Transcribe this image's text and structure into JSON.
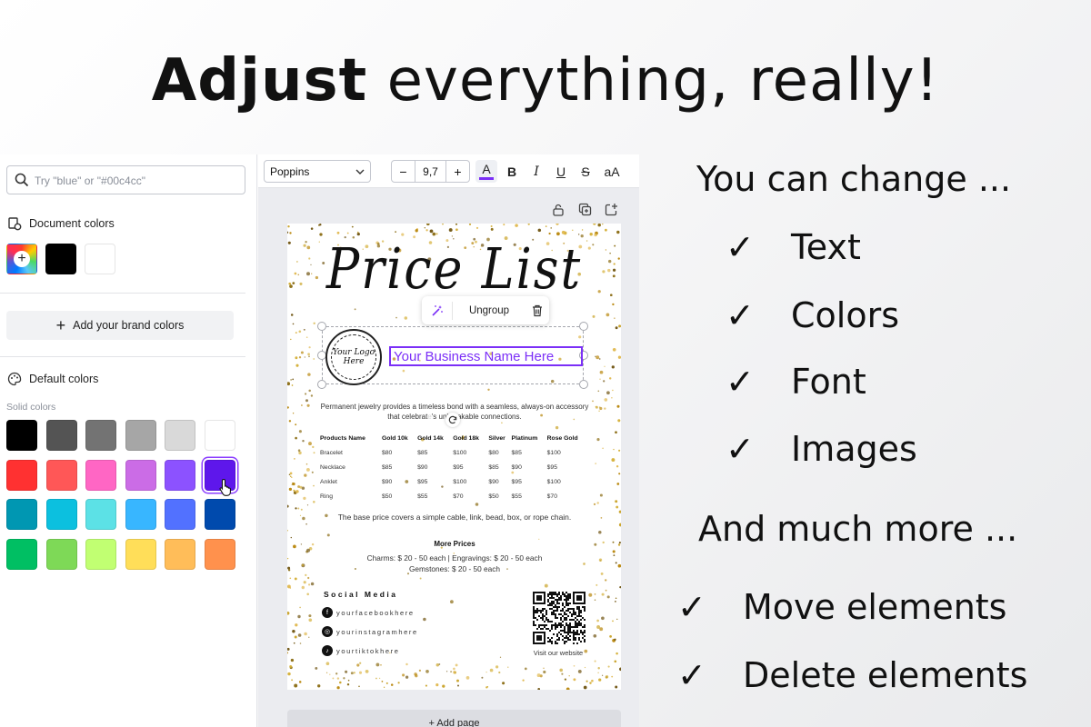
{
  "headline": {
    "bold": "Adjust",
    "rest": "everything, really!"
  },
  "panel": {
    "search_placeholder": "Try \"blue\" or \"#00c4cc\"",
    "document_colors_title": "Document colors",
    "document_colors": [
      "#000000",
      "#ffffff"
    ],
    "brand_button": "Add your brand colors",
    "default_colors_title": "Default colors",
    "solid_colors_label": "Solid colors",
    "solid_colors": [
      [
        "#000000",
        "#545454",
        "#737373",
        "#a6a6a6",
        "#d9d9d9",
        "#ffffff"
      ],
      [
        "#ff3131",
        "#ff5757",
        "#ff66c4",
        "#cb6ce6",
        "#8c52ff",
        "#5e17eb"
      ],
      [
        "#0097b2",
        "#0cc0df",
        "#5ce1e6",
        "#38b6ff",
        "#5271ff",
        "#004aad"
      ],
      [
        "#00bf63",
        "#7ed957",
        "#c1ff72",
        "#ffde59",
        "#ffbd59",
        "#ff914d"
      ]
    ],
    "selected_color": "#5e17eb"
  },
  "toolbar": {
    "font": "Poppins",
    "minus": "−",
    "font_size": "9,7",
    "plus": "+",
    "color_letter": "A",
    "text_color": "#7b2ff7",
    "bold": "B",
    "italic": "I",
    "underline": "U",
    "strike": "S",
    "case": "aA"
  },
  "flyer": {
    "title": "Price List",
    "context_menu": {
      "ungroup": "Ungroup"
    },
    "logo_text": "Your Logo Here",
    "business_name": "Your Business Name Here",
    "description": "Permanent jewelry provides a timeless bond with a seamless, always-on accessory that celebrat",
    "description_tail": "'s unbreakable connections.",
    "table": {
      "headers": [
        "Products Name",
        "Gold 10k",
        "Gold 14k",
        "Gold 18k",
        "Silver",
        "Platinum",
        "Rose Gold"
      ],
      "rows": [
        [
          "Bracelet",
          "$80",
          "$85",
          "$100",
          "$80",
          "$85",
          "$100"
        ],
        [
          "Necklace",
          "$85",
          "$90",
          "$95",
          "$85",
          "$90",
          "$95"
        ],
        [
          "Anklet",
          "$90",
          "$95",
          "$100",
          "$90",
          "$95",
          "$100"
        ],
        [
          "Ring",
          "$50",
          "$55",
          "$70",
          "$50",
          "$55",
          "$70"
        ]
      ]
    },
    "base_note": "The base price covers a simple cable, link, bead, box, or rope chain.",
    "more_prices_title": "More Prices",
    "more_prices_line1": "Charms: $ 20 - 50 each | Engravings: $ 20 - 50 each",
    "more_prices_line2": "Gemstones: $ 20 - 50 each",
    "social_title": "Social Media",
    "social": [
      "yourfacebookhere",
      "yourinstagramhere",
      "yourtiktokhere"
    ],
    "qr_label": "Visit our website",
    "accent": "#c9a227"
  },
  "add_page": "+ Add page",
  "features": {
    "heading1": "You can change ...",
    "list1": [
      "Text",
      "Colors",
      "Font",
      "Images"
    ],
    "heading2": "And much more ...",
    "list2": [
      "Move elements",
      "Delete elements"
    ],
    "check": "✓"
  }
}
